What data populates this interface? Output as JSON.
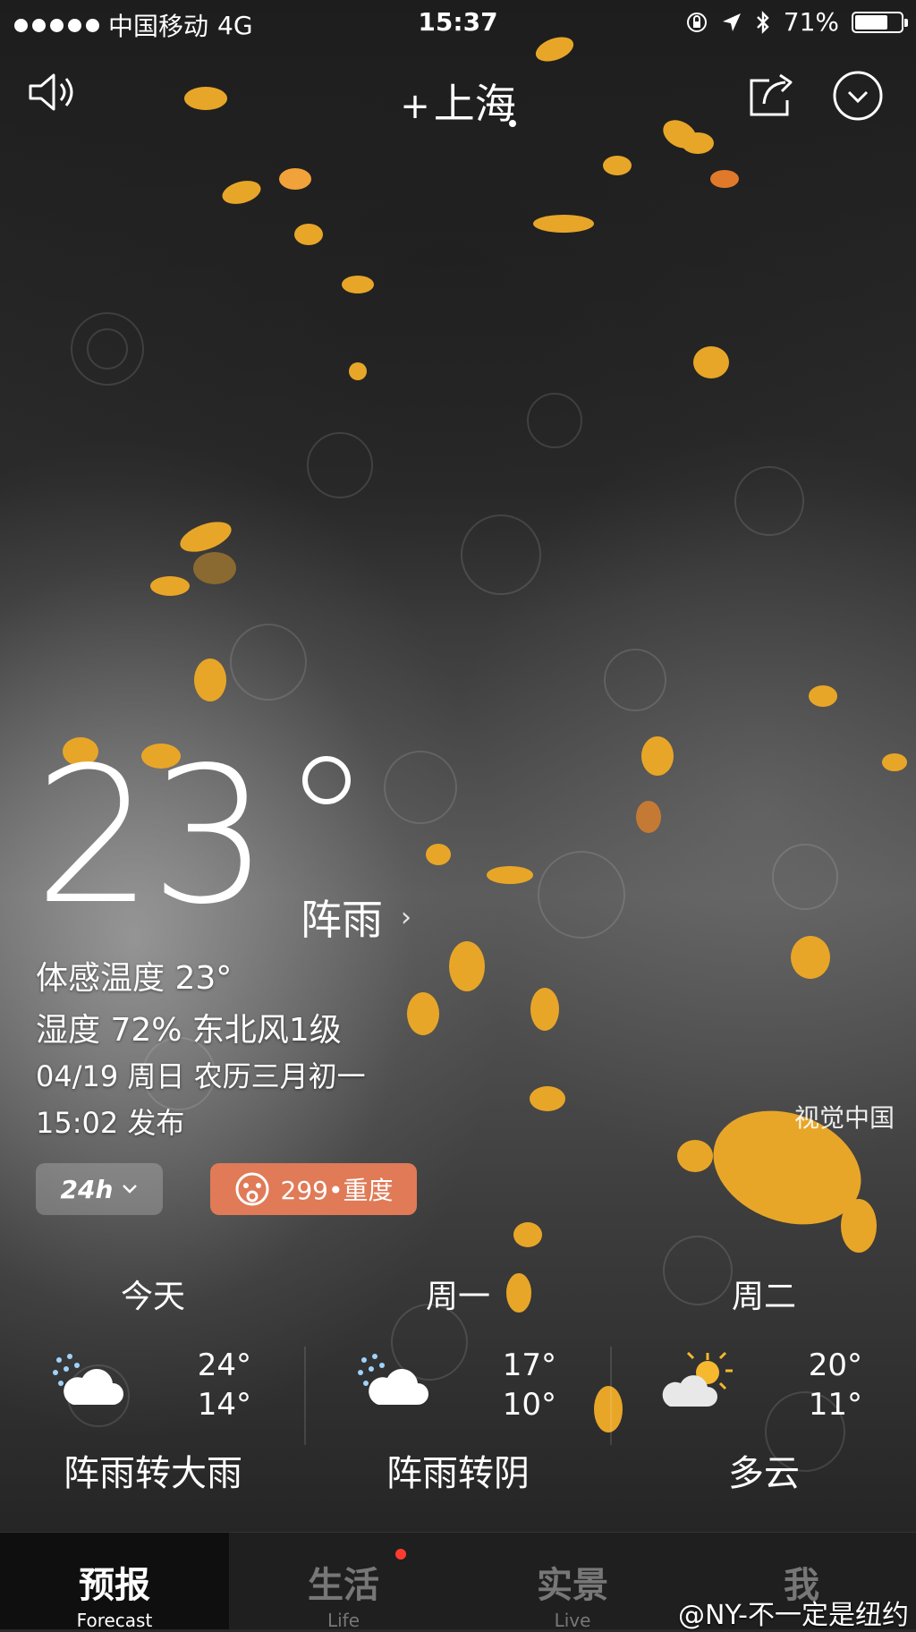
{
  "status_bar": {
    "carrier": "中国移动",
    "network": "4G",
    "time": "15:37",
    "battery": "71%",
    "battery_level": 0.71,
    "icons": [
      "signal-dots-icon",
      "rotation-lock-icon",
      "location-arrow-icon",
      "bluetooth-icon",
      "battery-icon"
    ]
  },
  "header": {
    "add_symbol": "+",
    "city": "上海",
    "icons": [
      "speaker-icon",
      "share-icon",
      "chevron-down-circle-icon"
    ]
  },
  "current": {
    "temperature": "23",
    "condition": "阵雨",
    "feels_like": "体感温度 23°",
    "humidity_wind": "湿度 72% 东北风1级",
    "date_line": "04/19 周日 农历三月初一",
    "published": "15:02 发布",
    "photo_credit": "视觉中国"
  },
  "controls": {
    "hours_toggle": "24h",
    "aqi_label": "299•重度",
    "aqi_color": "#e07a57"
  },
  "forecast": [
    {
      "day": "今天",
      "high": "24°",
      "low": "14°",
      "desc": "阵雨转大雨",
      "icon": "rain-cloud-icon"
    },
    {
      "day": "周一",
      "high": "17°",
      "low": "10°",
      "desc": "阵雨转阴",
      "icon": "rain-cloud-icon"
    },
    {
      "day": "周二",
      "high": "20°",
      "low": "11°",
      "desc": "多云",
      "icon": "sun-cloud-icon"
    }
  ],
  "tabs": [
    {
      "label": "预报",
      "sub": "Forecast",
      "active": true
    },
    {
      "label": "生活",
      "sub": "Life",
      "active": false,
      "badge": true
    },
    {
      "label": "实景",
      "sub": "Live",
      "active": false
    },
    {
      "label": "我",
      "sub": "",
      "active": false
    }
  ],
  "watermark": "@NY-不一定是纽约"
}
